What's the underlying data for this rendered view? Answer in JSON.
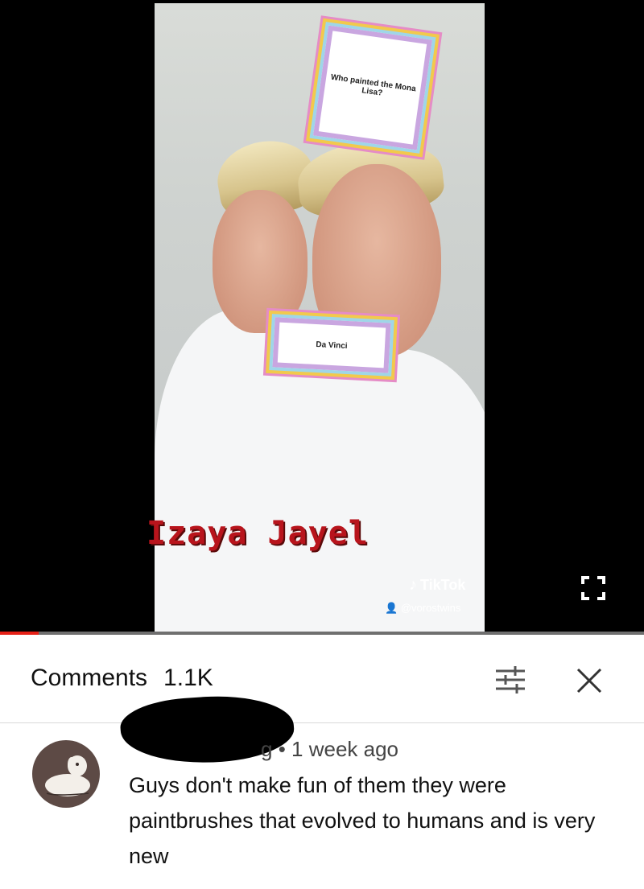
{
  "video": {
    "question_card": "Who painted the Mona Lisa?",
    "answer_card": "Da Vinci",
    "overlay_name": "Izaya Jayel",
    "watermark_brand": "TikTok",
    "watermark_handle": "@vorostwins",
    "progress_fraction": 0.06,
    "colors": {
      "progress": "#e62117",
      "overlay_name": "#b8141c"
    }
  },
  "comments": {
    "title": "Comments",
    "count": "1.1K",
    "icons": [
      "sort-filter-icon",
      "close-icon"
    ]
  },
  "comment": {
    "author_suffix": "g",
    "time": "1 week ago",
    "text": "Guys don't make fun of them they were paintbrushes that evolved to humans and is very new"
  }
}
